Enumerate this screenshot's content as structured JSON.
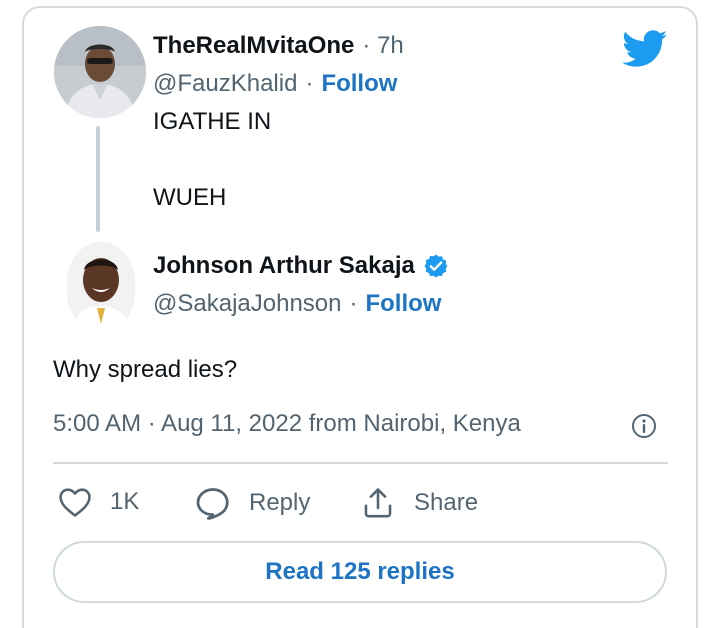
{
  "colors": {
    "accent": "#1d74c4",
    "twitter_blue": "#1d9bf0",
    "secondary_text": "#536471",
    "border": "#d6dadd"
  },
  "tweet_parent": {
    "display_name": "TheRealMvitaOne",
    "time_ago": "· 7h",
    "handle": "@FauzKhalid",
    "follow_sep": "·",
    "follow_label": "Follow",
    "text_line1": "IGATHE IN",
    "text_line2": "WUEH"
  },
  "tweet_reply": {
    "display_name": "Johnson Arthur Sakaja",
    "verified": true,
    "handle": "@SakajaJohnson",
    "follow_sep": "·",
    "follow_label": "Follow",
    "text": "Why spread lies?"
  },
  "timestamp": "5:00 AM · Aug 11, 2022 from Nairobi, Kenya",
  "actions": {
    "like_count": "1K",
    "reply_label": "Reply",
    "share_label": "Share"
  },
  "read_replies_label": "Read 125 replies",
  "icons": [
    "twitter-bird-icon",
    "verified-badge-icon",
    "info-icon",
    "heart-icon",
    "reply-bubble-icon",
    "share-icon"
  ]
}
